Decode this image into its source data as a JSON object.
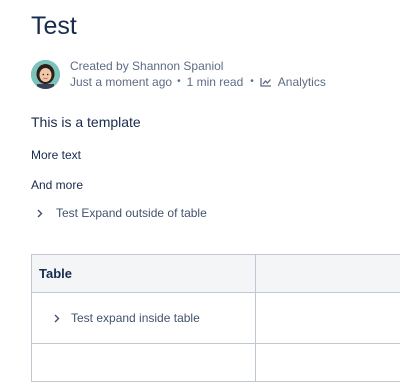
{
  "page": {
    "title": "Test"
  },
  "byline": {
    "created": "Created by Shannon Spaniol",
    "modified": "Just a moment ago",
    "read_time": "1 min read",
    "analytics_label": "Analytics",
    "separator": "•"
  },
  "content": {
    "paragraphs": [
      "This is a template",
      "More text",
      "And more"
    ],
    "expand_outside": "Test Expand outside of table"
  },
  "table": {
    "header": [
      "Table",
      ""
    ],
    "rows": [
      [
        "Test expand inside table",
        ""
      ],
      [
        "",
        ""
      ]
    ]
  },
  "icons": {
    "avatar": "user-avatar",
    "analytics": "analytics-chart-icon",
    "expand": "chevron-right-icon"
  },
  "colors": {
    "text": "#172b4d",
    "subtle": "#5e6c84",
    "border": "#c1c7d0",
    "header_bg": "#f4f5f7"
  }
}
